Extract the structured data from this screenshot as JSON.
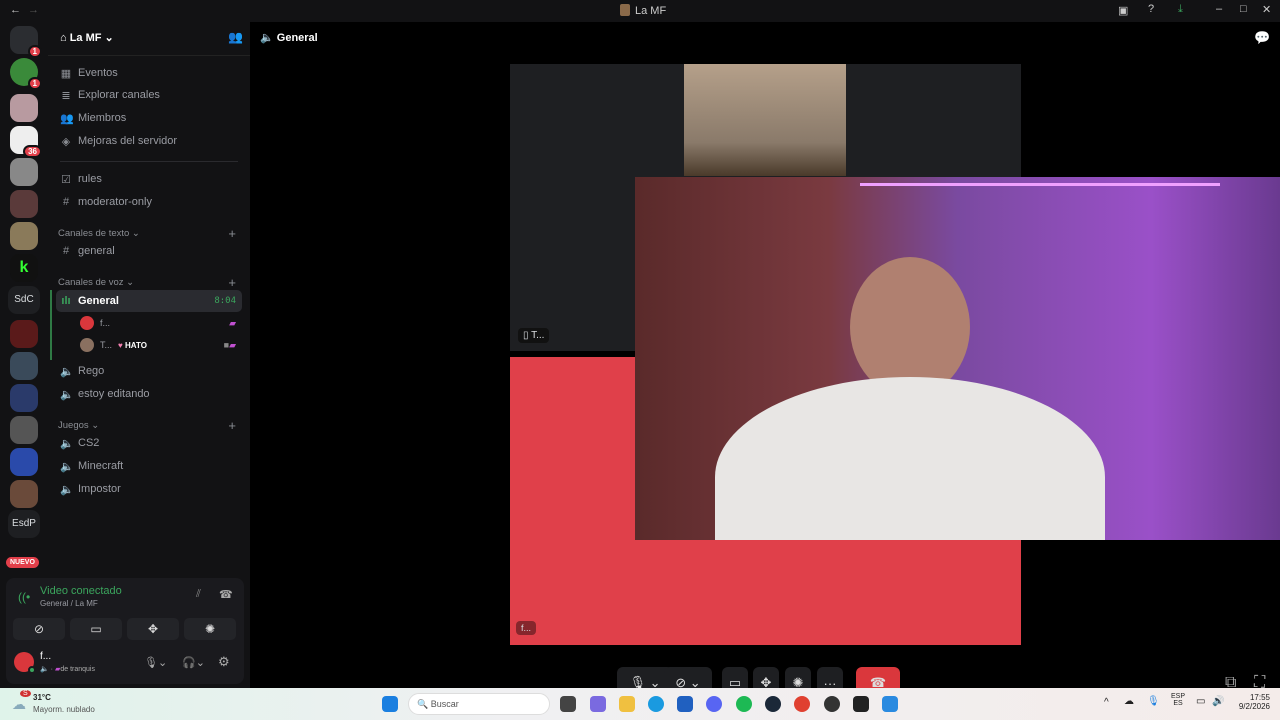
{
  "window": {
    "title": "La MF",
    "back": "←",
    "forward": "→"
  },
  "rail": {
    "badges": [
      "1",
      "1",
      "36"
    ],
    "text_servers": [
      "SdC",
      "EsdP"
    ],
    "new_label": "NUEVO"
  },
  "server": {
    "name": "La MF",
    "add_member_icon": "person-plus-icon",
    "menu": [
      {
        "label": "Eventos",
        "icon": "calendar-icon"
      },
      {
        "label": "Explorar canales",
        "icon": "browse-icon"
      },
      {
        "label": "Miembros",
        "icon": "members-icon"
      },
      {
        "label": "Mejoras del servidor",
        "icon": "boost-icon"
      }
    ],
    "pinned": [
      {
        "label": "rules",
        "icon": "rules-icon"
      },
      {
        "label": "moderator-only",
        "icon": "hash-lock-icon"
      }
    ],
    "categories": [
      {
        "label": "Canales de texto",
        "channels": [
          {
            "label": "general",
            "type": "text"
          }
        ]
      },
      {
        "label": "Canales de voz",
        "channels": [
          {
            "label": "General",
            "type": "voice",
            "active": true,
            "time": "8:04",
            "users": [
              {
                "name": "f..."
              },
              {
                "name": "T...",
                "tag": "HATO"
              }
            ]
          },
          {
            "label": "Rego",
            "type": "voice"
          },
          {
            "label": "estoy editando",
            "type": "voice"
          }
        ]
      },
      {
        "label": "Juegos",
        "channels": [
          {
            "label": "CS2",
            "type": "voice"
          },
          {
            "label": "Minecraft",
            "type": "voice"
          },
          {
            "label": "Impostor",
            "type": "voice"
          }
        ]
      }
    ]
  },
  "voice_panel": {
    "status": "Video conectado",
    "location": "General / La MF",
    "user": "f...",
    "user_status": "de tranquis"
  },
  "main": {
    "channel": "General",
    "tiles": [
      {
        "label": "T..."
      },
      {
        "label": "f..."
      }
    ]
  },
  "colors": {
    "accent_green": "#3ba55d",
    "red": "#da373c",
    "tile_red": "#e0404a"
  },
  "taskbar": {
    "weather_temp": "31°C",
    "weather_desc": "Mayorm. nublado",
    "weather_badge": "S",
    "search_placeholder": "Buscar",
    "lang_top": "ESP",
    "lang_bottom": "ES",
    "time": "17:55",
    "date": "9/2/2026"
  }
}
